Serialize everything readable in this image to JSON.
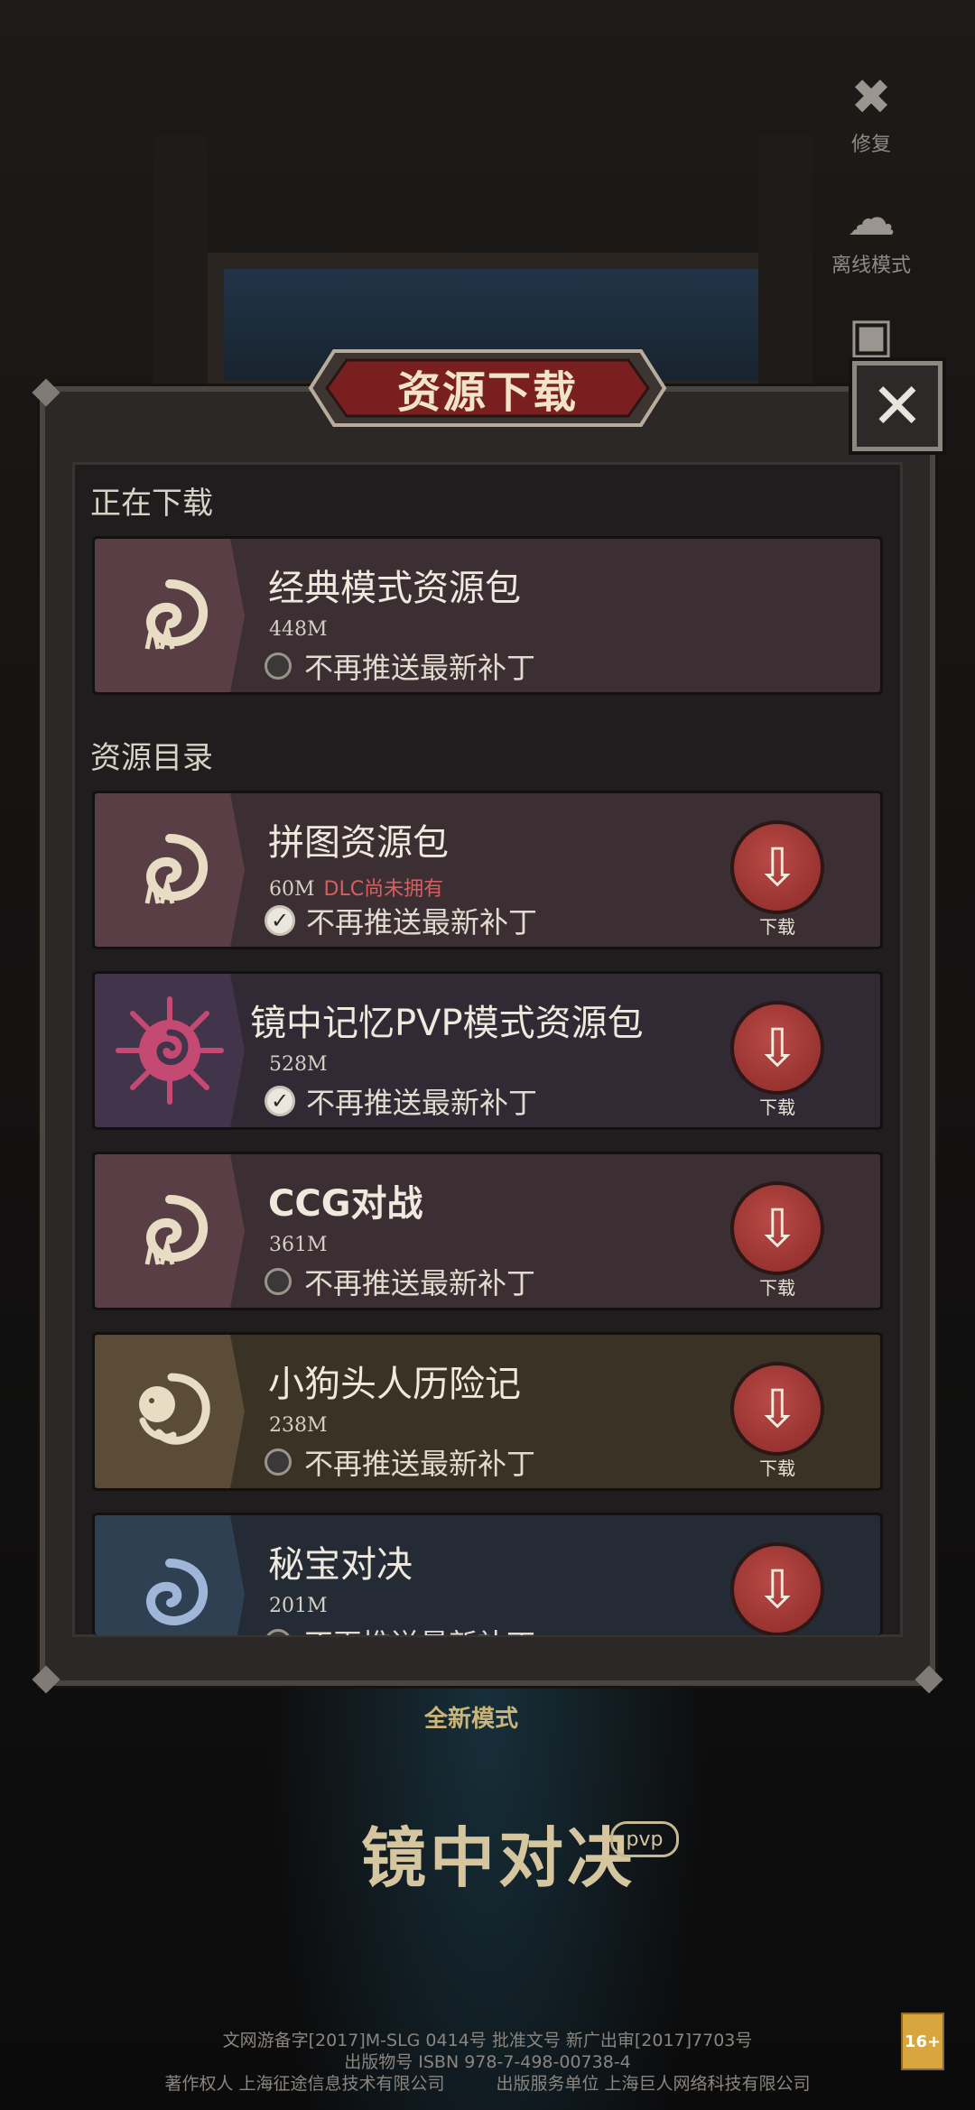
{
  "dialog": {
    "title": "资源下载",
    "close_icon": "close-icon"
  },
  "side_buttons": [
    {
      "label": "修复",
      "icon": "wrench-icon"
    },
    {
      "label": "离线模式",
      "icon": "cloud-offline-icon"
    },
    {
      "label": "",
      "icon": "scan-icon"
    }
  ],
  "sections": {
    "downloading": "正在下载",
    "catalog": "资源目录"
  },
  "downloading": [
    {
      "name": "经典模式资源包",
      "size": "448M",
      "option": "不再推送最新补丁",
      "checked": false,
      "icon": "spiral-icon",
      "bg": "#5a3e45"
    }
  ],
  "catalog": [
    {
      "name": "拼图资源包",
      "size": "60M",
      "badge": "DLC尚未拥有",
      "option": "不再推送最新补丁",
      "checked": true,
      "button": "下载",
      "icon": "spiral-icon",
      "bg": "#5a3e45"
    },
    {
      "name": "镜中记忆PVP模式资源包",
      "size": "528M",
      "badge": "",
      "option": "不再推送最新补丁",
      "checked": true,
      "button": "下载",
      "icon": "spiky-spiral-icon",
      "bg": "#42344a"
    },
    {
      "name": "CCG对战",
      "size": "361M",
      "badge": "",
      "option": "不再推送最新补丁",
      "checked": false,
      "button": "下载",
      "icon": "spiral-icon",
      "bg": "#5a3e45"
    },
    {
      "name": "小狗头人历险记",
      "size": "238M",
      "badge": "",
      "option": "不再推送最新补丁",
      "checked": false,
      "button": "下载",
      "icon": "dog-spiral-icon",
      "bg": "#5a4c36"
    },
    {
      "name": "秘宝对决",
      "size": "201M",
      "badge": "",
      "option": "不再推送最新补丁",
      "checked": false,
      "button": "下载",
      "icon": "blue-spiral-icon",
      "bg": "#2f4052"
    }
  ],
  "footer": {
    "mode": "全新模式",
    "logo": "镜中对决",
    "logo_badge": "pvp",
    "line1": "文网游备字[2017]M-SLG 0414号 批准文号 新广出审[2017]7703号",
    "line2": "出版物号 ISBN 978-7-498-00738-4",
    "line3": "著作权人 上海征途信息技术有限公司　　　出版服务单位 上海巨人网络科技有限公司",
    "age": "16+"
  }
}
